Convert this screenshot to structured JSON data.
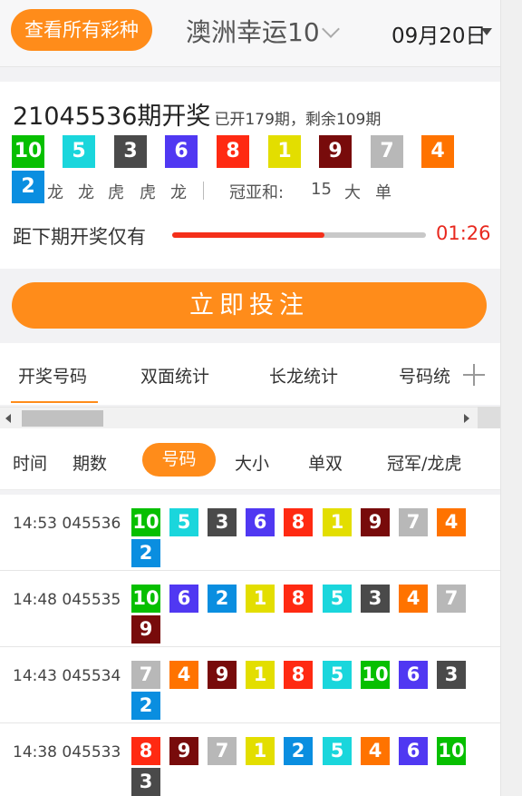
{
  "header": {
    "all_lotteries": "查看所有彩种",
    "game": "澳洲幸运10",
    "date": "09月20日"
  },
  "draw": {
    "issue": "21045536期开奖",
    "stats": "已开179期，剩余109期",
    "numbers": [
      10,
      5,
      3,
      6,
      8,
      1,
      9,
      7,
      4,
      2
    ],
    "dragon_tiger": [
      "龙",
      "龙",
      "虎",
      "虎",
      "龙"
    ],
    "sum_label": "冠亚和:",
    "sum_value": "15",
    "size": "大",
    "parity": "单",
    "countdown_label": "距下期开奖仅有",
    "countdown": "01:26",
    "progress": 0.6
  },
  "bet_button": "立即投注",
  "tabs": [
    "开奖号码",
    "双面统计",
    "长龙统计",
    "号码统"
  ],
  "filters": {
    "time": "时间",
    "issue": "期数",
    "number": "号码",
    "size": "大小",
    "parity": "单双",
    "champion": "冠军/龙虎"
  },
  "colors": {
    "1": "#e3de00",
    "2": "#0a8ee0",
    "3": "#4a4a4a",
    "4": "#ff7300",
    "5": "#1ad6dc",
    "6": "#5038f2",
    "7": "#b8b8b8",
    "8": "#ff2a12",
    "9": "#780b0b",
    "10": "#07bf00",
    "accent": "#ff8c1a",
    "countdown": "#e8281e"
  },
  "history": [
    {
      "time": "14:53",
      "issue": "045536",
      "numbers": [
        10,
        5,
        3,
        6,
        8,
        1,
        9,
        7,
        4,
        2
      ]
    },
    {
      "time": "14:48",
      "issue": "045535",
      "numbers": [
        10,
        6,
        2,
        1,
        8,
        5,
        3,
        4,
        7,
        9
      ]
    },
    {
      "time": "14:43",
      "issue": "045534",
      "numbers": [
        7,
        4,
        9,
        1,
        8,
        5,
        10,
        6,
        3,
        2
      ]
    },
    {
      "time": "14:38",
      "issue": "045533",
      "numbers": [
        8,
        9,
        7,
        1,
        2,
        5,
        4,
        6,
        10,
        3
      ]
    }
  ]
}
